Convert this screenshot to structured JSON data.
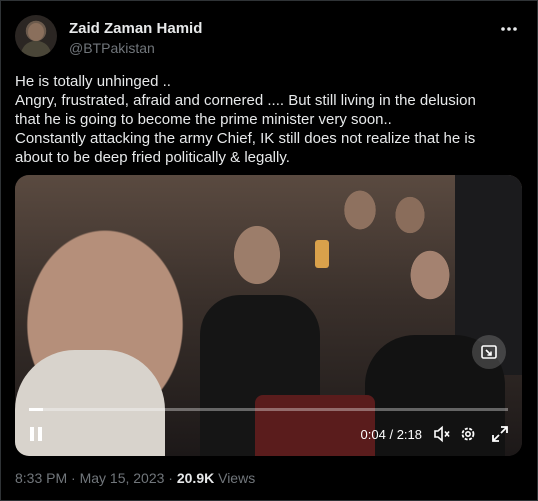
{
  "author": {
    "name": "Zaid Zaman Hamid",
    "handle": "@BTPakistan"
  },
  "tweet": {
    "lines": [
      "He is totally unhinged ..",
      "Angry, frustrated, afraid and cornered .... But still living in the delusion",
      "that he is going to become the prime minister very soon..",
      "Constantly attacking the army Chief, IK still does not realize that he is",
      "about to be deep fried politically & legally."
    ]
  },
  "video": {
    "current_time": "0:04",
    "separator": "/",
    "duration": "2:18",
    "progress_fraction": 0.029
  },
  "footer": {
    "timestamp": "8:33 PM · May 15, 2023 · ",
    "views_count": "20.9K",
    "views_label": " Views"
  },
  "icons": {
    "more": "more-horizontal-icon",
    "pip": "picture-in-picture-icon",
    "pause": "pause-icon",
    "volume": "volume-muted-icon",
    "settings": "gear-icon",
    "fullscreen": "expand-icon"
  },
  "colors": {
    "background": "#000000",
    "text": "#e7e9ea",
    "secondary": "#71767b"
  }
}
